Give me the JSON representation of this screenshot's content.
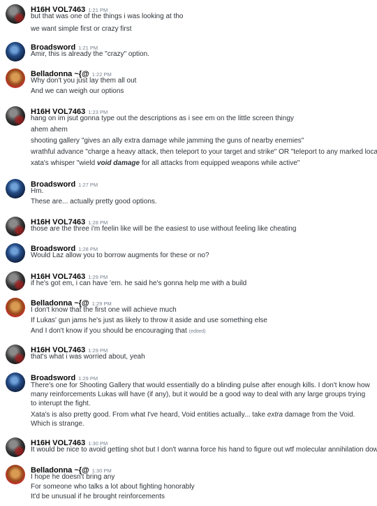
{
  "messages": [
    {
      "author": "H16H VOL7463",
      "time": "1:21 PM",
      "lines": [
        "but that was one of the things i was looking at tho",
        "we want simple first or crazy first"
      ]
    },
    {
      "author": "Broadsword",
      "time": "1:21 PM",
      "lines": [
        "Amir, this is already the \"crazy\" option."
      ]
    },
    {
      "author": "Belladonna ~{@",
      "time": "1:22 PM",
      "lines": [
        "Why don't you just lay them all out",
        "And we can weigh our options"
      ]
    },
    {
      "author": "H16H VOL7463",
      "time": "1:23 PM",
      "lines": [
        "hang on im jsut gonna type out the descriptions as i see em on the little screen thingy",
        "ahem ahem",
        "shooting gallery \"gives an ally extra damage while jamming the guns of nearby enemies\"",
        "wrathful advance \"charge a heavy attack, then teleport to your target and strike\" OR \"teleport to any marked location\"",
        "xata's whisper \"wield ",
        "void damage",
        " for all attacks from equipped weapons while active\""
      ]
    },
    {
      "author": "Broadsword",
      "time": "1:27 PM",
      "lines": [
        "Hm.",
        "These are... actually pretty good options."
      ]
    },
    {
      "author": "H16H VOL7463",
      "time": "1:28 PM",
      "lines": [
        "those are the three i'm feelin like will be the easiest to use without feeling like cheating"
      ]
    },
    {
      "author": "Broadsword",
      "time": "1:28 PM",
      "lines": [
        "Would Laz allow you to borrow augments for these or no?"
      ]
    },
    {
      "author": "H16H VOL7463",
      "time": "1:29 PM",
      "lines": [
        "if he's got em, i can have 'em. he said he's gonna help me with a build"
      ]
    },
    {
      "author": "Belladonna ~{@",
      "time": "1:29 PM",
      "lines": [
        "I don't know that the first one will achieve much",
        "If Lukas' gun jams he's just as likely to throw it aside and use something else",
        "And I don't know if you should be encouraging that"
      ],
      "edited": "(edited)"
    },
    {
      "author": "H16H VOL7463",
      "time": "1:29 PM",
      "lines": [
        "that's what i was worried about, yeah"
      ]
    },
    {
      "author": "Broadsword",
      "time": "1:29 PM",
      "lines": [
        "There's one for Shooting Gallery that would essentially do a blinding pulse after enough kills. I don't know how many reinforcements Lukas will have (if any), but it would be a good way to deal with any large groups trying to interupt the fight.",
        "Xata's is also pretty good. From what I've heard, Void entities actually... take ",
        "extra",
        " damage from the Void. Which is strange."
      ]
    },
    {
      "author": "H16H VOL7463",
      "time": "1:30 PM",
      "lines": [
        "It would be nice to avoid getting shot but I don't wanna force his hand to figure out wtf molecular annihilation dows"
      ]
    },
    {
      "author": "Belladonna ~{@",
      "time": "1:30 PM",
      "lines": [
        "I hope he doesn't bring any",
        "For someone who talks a lot about fighting honorably",
        "It'd be unusual if he brought reinforcements"
      ]
    }
  ]
}
